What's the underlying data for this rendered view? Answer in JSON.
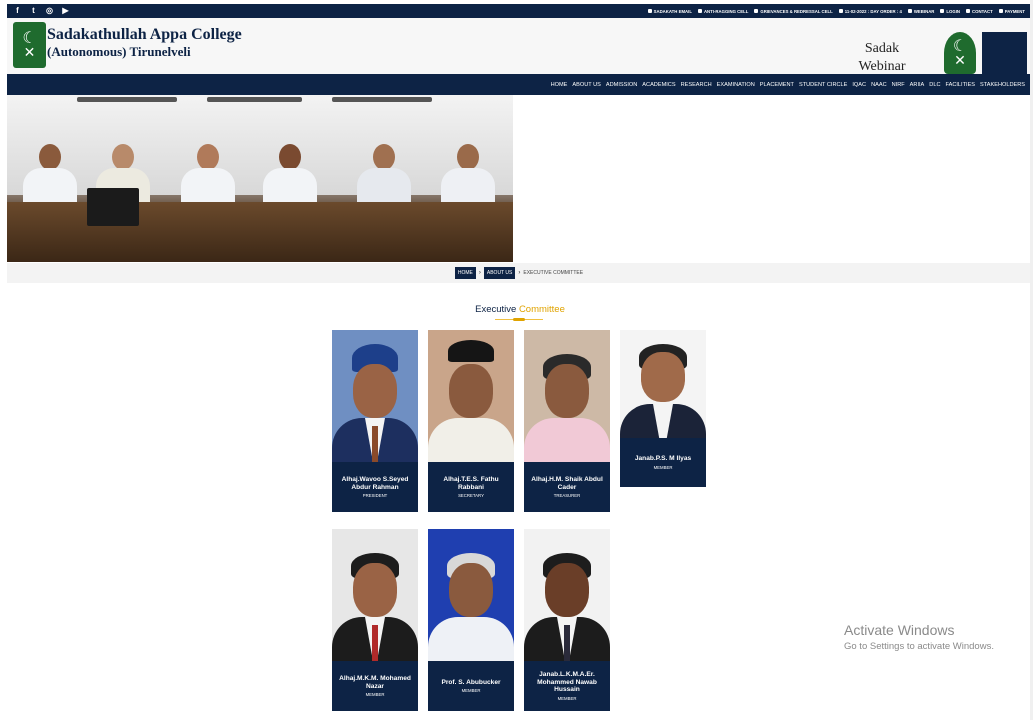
{
  "topbar": {
    "social": [
      {
        "icon": "facebook-icon",
        "glyph": "f"
      },
      {
        "icon": "twitter-icon",
        "glyph": "t"
      },
      {
        "icon": "instagram-icon",
        "glyph": "◎"
      },
      {
        "icon": "youtube-icon",
        "glyph": "▶"
      }
    ],
    "links": [
      {
        "icon": "mail-icon",
        "label": "SADAKATH EMAIL"
      },
      {
        "icon": "building-icon",
        "label": "ANTI-RAGGING CELL"
      },
      {
        "icon": "map-pin-icon",
        "label": "GRIEVANCES & REDRESSAL CELL"
      },
      {
        "icon": "calendar-icon",
        "label": "11-02-2022 : DAY ORDER : 4"
      },
      {
        "icon": "video-icon",
        "label": "WEBINAR"
      },
      {
        "icon": "login-icon",
        "label": "LOGIN"
      },
      {
        "icon": "phone-icon",
        "label": "CONTACT"
      },
      {
        "icon": "credit-card-icon",
        "label": "PAYMENT"
      }
    ]
  },
  "header": {
    "college_line1": "Sadakathullah Appa College",
    "college_line2": "(Autonomous) Tirunelveli",
    "webinar_text": "Sadak Webinar Series"
  },
  "nav": {
    "items": [
      "HOME",
      "ABOUT US",
      "ADMISSION",
      "ACADEMICS",
      "RESEARCH",
      "EXAMINATION",
      "PLACEMENT",
      "STUDENT CIRCLE",
      "IQAC",
      "NAAC",
      "NIRF",
      "ARIIA",
      "DLC",
      "FACILITIES",
      "STAKEHOLDERS"
    ]
  },
  "breadcrumb": {
    "home": "HOME",
    "about": "ABOUT US",
    "current": "EXECUTIVE COMMITTEE"
  },
  "section": {
    "title_part1": "Executive",
    "title_part2": "Committee"
  },
  "members": [
    {
      "name": "Alhaj.Wavoo S.Seyed Abdur Rahman",
      "role": "PRESIDENT"
    },
    {
      "name": "Alhaj.T.E.S. Fathu Rabbani",
      "role": "SECRETARY"
    },
    {
      "name": "Alhaj.H.M. Shaik Abdul Cader",
      "role": "TREASURER"
    },
    {
      "name": "Janab.P.S. M Ilyas",
      "role": "MEMBER"
    },
    {
      "name": "Alhaj.M.K.M. Mohamed Nazar",
      "role": "MEMBER"
    },
    {
      "name": "Prof. S. Abubucker",
      "role": "MEMBER"
    },
    {
      "name": "Janab.L.K.M.A.Er. Mohammed Nawab Hussain",
      "role": "MEMBER"
    }
  ],
  "watermark": {
    "line1": "Activate Windows",
    "line2": "Go to Settings to activate Windows."
  },
  "colors": {
    "navy": "#0d2345",
    "accent": "#e0a300",
    "logo_green": "#1f6b2e"
  }
}
